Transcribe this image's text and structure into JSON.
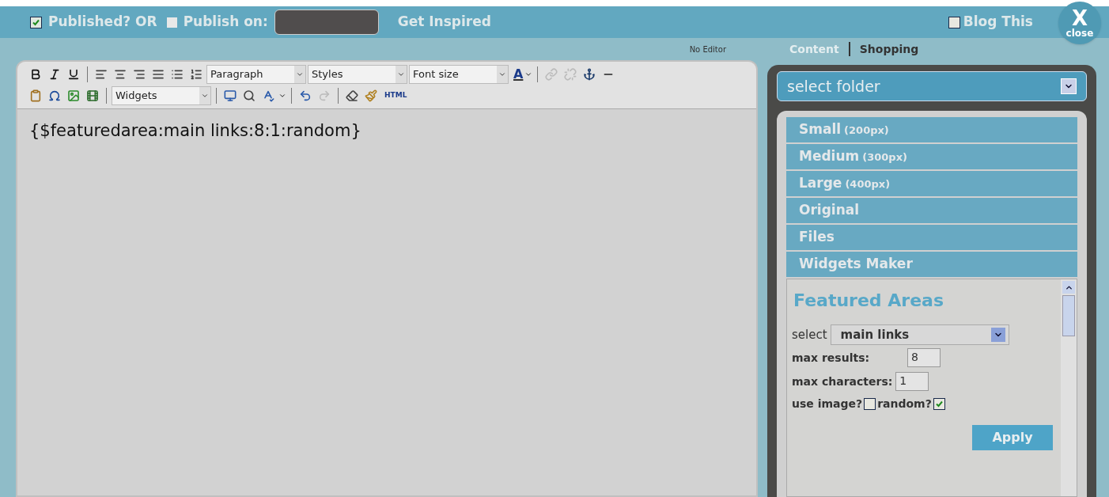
{
  "top_bar": {
    "published": {
      "label": "Published? OR",
      "checked": true
    },
    "publish_on": {
      "label": "Publish on:",
      "checked": false
    },
    "get_inspired": "Get Inspired",
    "blog_this": {
      "label": "Blog This",
      "checked": false
    },
    "close": {
      "symbol": "X",
      "label": "close"
    }
  },
  "editor": {
    "mode_link": "No Editor",
    "dropdowns": [
      "Paragraph",
      "Styles",
      "Font size"
    ],
    "text_color": "A",
    "widgets": "Widgets",
    "html": "HTML",
    "content": "{$featuredarea:main links:8:1:random}"
  },
  "side": {
    "tabs": [
      {
        "label": "Content",
        "selected": true
      },
      {
        "label": "Shopping",
        "selected": false
      }
    ],
    "folder": "select folder",
    "sections": [
      {
        "label": "Small",
        "size": "(200px)"
      },
      {
        "label": "Medium",
        "size": "(300px)"
      },
      {
        "label": "Large",
        "size": "(400px)"
      },
      {
        "label": "Original"
      },
      {
        "label": "Files"
      },
      {
        "label": "Widgets Maker"
      }
    ],
    "featured": {
      "title": "Featured Areas",
      "select_label": "select",
      "select_value": "main links",
      "max_results_label": "max results:",
      "max_results": "8",
      "max_chars_label": "max characters:",
      "max_chars": "1",
      "use_image": {
        "label": "use image?",
        "checked": false
      },
      "random": {
        "label": "random?",
        "checked": true
      },
      "apply": "Apply"
    }
  }
}
